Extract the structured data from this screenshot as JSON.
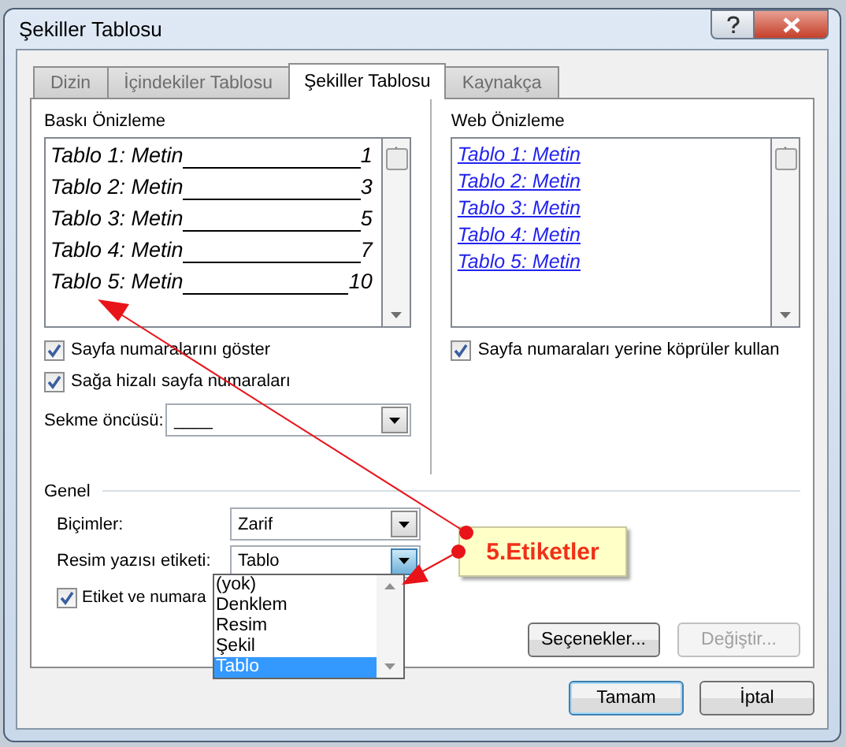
{
  "window": {
    "title": "Şekiller Tablosu"
  },
  "tabs": [
    {
      "label": "Dizin",
      "selected": false
    },
    {
      "label": "İçindekiler Tablosu",
      "selected": false
    },
    {
      "label": "Şekiller Tablosu",
      "selected": true
    },
    {
      "label": "Kaynakça",
      "selected": false
    }
  ],
  "print_preview": {
    "label": "Baskı Önizleme",
    "entries": [
      {
        "text": "Tablo 1: Metin",
        "page": "1"
      },
      {
        "text": "Tablo 2: Metin",
        "page": "3"
      },
      {
        "text": "Tablo 3: Metin",
        "page": "5"
      },
      {
        "text": "Tablo 4: Metin",
        "page": "7"
      },
      {
        "text": "Tablo 5: Metin",
        "page": "10"
      }
    ]
  },
  "show_page_numbers": {
    "label": "Sayfa numaralarını göster",
    "checked": true
  },
  "right_align": {
    "label": "Sağa hizalı sayfa numaraları",
    "checked": true
  },
  "tab_leader": {
    "label": "Sekme öncüsü:",
    "value": "____"
  },
  "web_preview": {
    "label": "Web Önizleme",
    "entries": [
      "Tablo 1: Metin",
      "Tablo 2: Metin",
      "Tablo 3: Metin",
      "Tablo 4: Metin",
      "Tablo 5: Metin"
    ]
  },
  "use_hyperlinks": {
    "label": "Sayfa numaraları yerine köprüler kullan",
    "checked": true
  },
  "general": {
    "label": "Genel",
    "formats": {
      "label": "Biçimler:",
      "value": "Zarif"
    },
    "caption_label": {
      "label": "Resim yazısı etiketi:",
      "value": "Tablo",
      "expanded": true,
      "options": [
        {
          "label": "(yok)",
          "selected": false
        },
        {
          "label": "Denklem",
          "selected": false
        },
        {
          "label": "Resim",
          "selected": false
        },
        {
          "label": "Şekil",
          "selected": false
        },
        {
          "label": "Tablo",
          "selected": true
        }
      ]
    },
    "include_label": {
      "label": "Etiket ve numara",
      "checked": true
    }
  },
  "buttons": [
    {
      "label": "Seçenekler...",
      "disabled": false
    },
    {
      "label": "Değiştir...",
      "disabled": true
    }
  ],
  "dialog_buttons": [
    {
      "label": "Tamam",
      "default": true
    },
    {
      "label": "İptal",
      "default": false
    }
  ],
  "callout": {
    "text": "5.Etiketler"
  }
}
